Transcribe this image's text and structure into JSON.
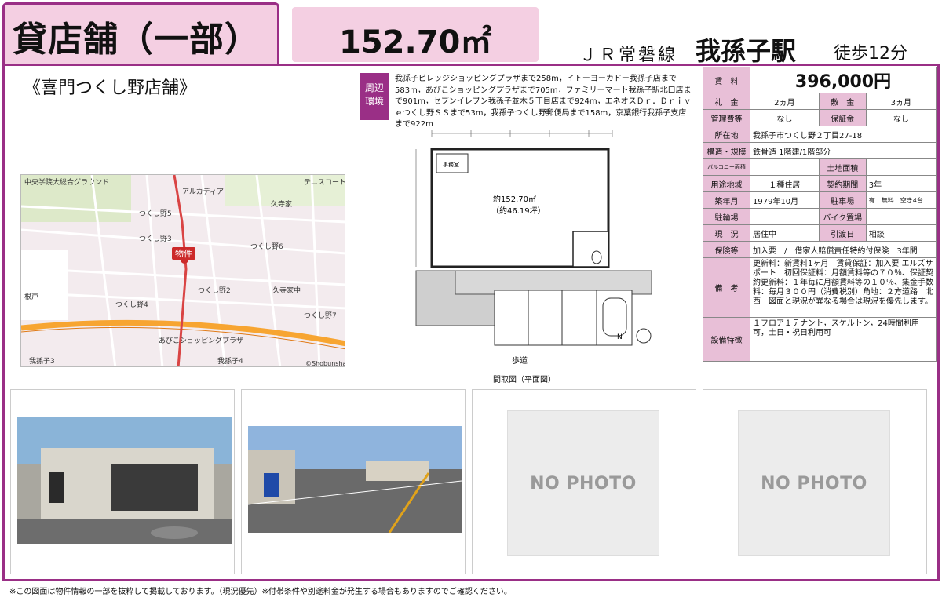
{
  "header": {
    "property_type": "貸店舗（一部）",
    "area": "152.70㎡",
    "line": "ＪＲ常磐線",
    "station": "我孫子駅",
    "walk": "徒歩12分"
  },
  "shop_name": "《喜門つくし野店舗》",
  "environment": {
    "tag_line1": "周辺",
    "tag_line2": "環境",
    "text": "我孫子ビレッジショッピングプラザまで258m，イトーヨーカドー我孫子店まで583m，あびこショッピングプラザまで705m，ファミリーマート我孫子駅北口店まで901m，セブンイレブン我孫子並木５丁目店まで924m，エネオスＤｒ．Ｄｒｉｖｅつくし野ＳＳまで53m，我孫子つくし野郵便局まで158m，京葉銀行我孫子支店まで922m"
  },
  "map": {
    "labels": [
      "中央学院大総合グラウンド",
      "アルカディア",
      "つくし野5",
      "久寺家",
      "つくし野3",
      "つくし野6",
      "物件",
      "つくし野2",
      "根戸",
      "つくし野4",
      "つくし野7",
      "我孫子3",
      "あびこショッピングプラザ",
      "我孫子4",
      "久寺家中",
      "テニスコート",
      "©Shobunsha"
    ],
    "marker_label": "物件"
  },
  "floorplan": {
    "area_text": "約152.70㎡",
    "tsubo_text": "（約46.19坪）",
    "office_label": "事務室",
    "road_label": "歩道",
    "caption": "間取図（平面図）",
    "north": "N"
  },
  "spec": {
    "rent_label": "賃　料",
    "rent_value": "396,000円",
    "key_money_label": "礼　金",
    "key_money_value": "2ヵ月",
    "deposit_label": "敷　金",
    "deposit_value": "3ヵ月",
    "mgmt_label": "管理費等",
    "mgmt_value": "なし",
    "guarantee_label": "保証金",
    "guarantee_value": "なし",
    "address_label": "所在地",
    "address_value": "我孫子市つくし野２丁目27-18",
    "structure_label": "構造・規模",
    "structure_value": "鉄骨造 1階建/1階部分",
    "balcony_label": "バルコニー面積",
    "balcony_value": "",
    "land_area_label": "土地面積",
    "land_area_value": "",
    "zoning_label": "用途地域",
    "zoning_value": "１種住居",
    "contract_label": "契約期間",
    "contract_value": "3年",
    "built_label": "築年月",
    "built_value": "1979年10月",
    "parking_label": "駐車場",
    "parking_value": "有　無料　空き4台",
    "bicycle_label": "駐輪場",
    "bicycle_value": "",
    "bike_label": "バイク置場",
    "bike_value": "",
    "status_label": "現　況",
    "status_value": "居住中",
    "handover_label": "引渡日",
    "handover_value": "相談",
    "insurance_label": "保険等",
    "insurance_value": "加入要　/　借家人賠償責任特約付保険　3年間",
    "remarks_label": "備　考",
    "remarks_value": "更新料：新賃料1ヶ月　賃貸保証：加入要 エルズサポート　初回保証料：月額賃料等の７０％、保証契約更新料：１年毎に月額賃料等の１０％、集金手数料：毎月３００円（消費税別）角地：２方道路　北　西　図面と現況が異なる場合は現況を優先します。",
    "features_label": "設備特徴",
    "features_value": "１フロア１テナント，スケルトン，24時間利用可，土日・祝日利用可"
  },
  "photos": {
    "no_photo_1": "NO PHOTO",
    "no_photo_2": "NO PHOTO"
  },
  "footer": "※この図面は物件情報の一部を抜粋して掲載しております。（現況優先）※付帯条件や別途料金が発生する場合もありますのでご確認ください。",
  "colors": {
    "accent": "#9a2f86",
    "header_bg": "#f4cfe2",
    "label_bg": "#e8bfd7"
  }
}
